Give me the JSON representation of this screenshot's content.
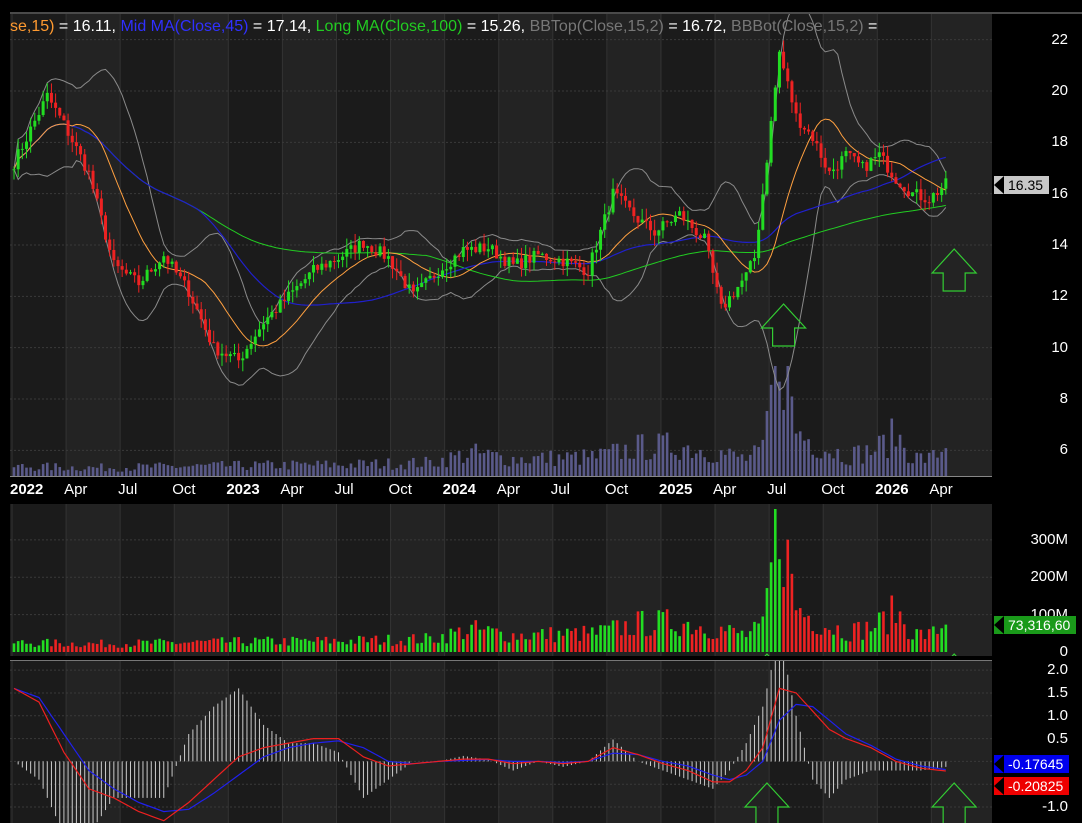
{
  "legend": [
    {
      "text": "se,15)",
      "color": "#ff9a30"
    },
    {
      "text": " = 16.11, ",
      "color": "#ffffff"
    },
    {
      "text": "Mid MA(Close,45)",
      "color": "#3030ff"
    },
    {
      "text": " = 17.14, ",
      "color": "#ffffff"
    },
    {
      "text": "Long MA(Close,100)",
      "color": "#22cc22"
    },
    {
      "text": " = 15.26, ",
      "color": "#ffffff"
    },
    {
      "text": "BBTop(Close,15,2)",
      "color": "#777777"
    },
    {
      "text": " = 16.72, ",
      "color": "#ffffff"
    },
    {
      "text": "BBBot(Close,15,2)",
      "color": "#777777"
    },
    {
      "text": " = ",
      "color": "#ffffff"
    }
  ],
  "x_labels": [
    {
      "text": "2022",
      "year": true,
      "week": 0
    },
    {
      "text": "Apr",
      "year": false,
      "week": 13
    },
    {
      "text": "Jul",
      "year": false,
      "week": 26
    },
    {
      "text": "Oct",
      "year": false,
      "week": 39
    },
    {
      "text": "2023",
      "year": true,
      "week": 52
    },
    {
      "text": "Apr",
      "year": false,
      "week": 65
    },
    {
      "text": "Jul",
      "year": false,
      "week": 78
    },
    {
      "text": "Oct",
      "year": false,
      "week": 91
    },
    {
      "text": "2024",
      "year": true,
      "week": 104
    },
    {
      "text": "Apr",
      "year": false,
      "week": 117
    },
    {
      "text": "Jul",
      "year": false,
      "week": 130
    },
    {
      "text": "Oct",
      "year": false,
      "week": 143
    },
    {
      "text": "2025",
      "year": true,
      "week": 156
    },
    {
      "text": "Apr",
      "year": false,
      "week": 169
    },
    {
      "text": "Jul",
      "year": false,
      "week": 182
    },
    {
      "text": "Oct",
      "year": false,
      "week": 195
    },
    {
      "text": "2026",
      "year": true,
      "week": 208
    },
    {
      "text": "Apr",
      "year": false,
      "week": 221
    }
  ],
  "price_axis": {
    "ticks": [
      "22",
      "20",
      "18",
      "16",
      "14",
      "12",
      "10",
      "8",
      "6"
    ],
    "current": "16.35"
  },
  "volume_axis": {
    "ticks": [
      "300M",
      "200M",
      "100M",
      "0"
    ],
    "current": "73,316,60"
  },
  "macd_axis": {
    "ticks": [
      "2.0",
      "1.5",
      "1.0",
      "0.5",
      "0",
      "-0.5",
      "-1.0"
    ],
    "macd_value": "-0.17645",
    "signal_value": "-0.20825"
  },
  "colors": {
    "up": "#22dd22",
    "down": "#ee2222",
    "short_ma": "#ffa040",
    "mid_ma": "#2020cc",
    "long_ma": "#22cc22",
    "bollinger": "#8a8a8a",
    "vol_overlay": "#5a5a8a",
    "macd": "#ee2020",
    "signal": "#2020ee",
    "hist": "#cccccc",
    "arrow": "#33cc33"
  },
  "chart_data": [
    {
      "type": "line",
      "title": "",
      "x_unit": "week index from Jan 2022",
      "ylim": [
        5,
        23
      ],
      "anchors_x": [
        0,
        8,
        12,
        18,
        24,
        30,
        36,
        42,
        48,
        54,
        60,
        66,
        72,
        78,
        84,
        90,
        96,
        102,
        108,
        114,
        120,
        126,
        132,
        138,
        144,
        150,
        154,
        160,
        166,
        170,
        176,
        178,
        180,
        184,
        188,
        192,
        196,
        200,
        204,
        208,
        212,
        216,
        220,
        224
      ],
      "close": [
        17.2,
        19.8,
        18.7,
        16.8,
        13.2,
        12.5,
        13.6,
        12.2,
        10.0,
        9.5,
        11.0,
        12.0,
        13.0,
        13.5,
        14.1,
        13.5,
        12.0,
        13.0,
        13.8,
        13.9,
        13.2,
        13.6,
        13.4,
        13.0,
        16.0,
        15.0,
        14.5,
        15.2,
        14.2,
        11.5,
        12.8,
        13.5,
        16.0,
        21.5,
        19.0,
        18.2,
        16.8,
        17.5,
        17.0,
        17.5,
        16.6,
        16.0,
        15.8,
        16.35
      ],
      "short_ma_last": 16.11,
      "mid_ma_last": 17.14,
      "long_ma_last": 15.26,
      "bb_top_last": 16.72,
      "grid": true
    },
    {
      "type": "bar",
      "title": "",
      "ylim": [
        0,
        380
      ],
      "y_unit": "millions",
      "anchors_x": [
        0,
        20,
        40,
        60,
        80,
        100,
        110,
        120,
        140,
        150,
        160,
        170,
        176,
        180,
        184,
        188,
        192,
        196,
        200,
        204,
        208,
        212,
        216,
        220,
        224
      ],
      "volume": [
        25,
        22,
        25,
        28,
        30,
        35,
        60,
        45,
        50,
        75,
        80,
        60,
        45,
        65,
        370,
        120,
        90,
        70,
        55,
        60,
        75,
        110,
        50,
        45,
        73.3
      ],
      "last_volume": 73.3166
    },
    {
      "type": "line",
      "title": "",
      "ylim": [
        -1.35,
        2.2
      ],
      "anchors_x": [
        0,
        6,
        12,
        18,
        24,
        30,
        36,
        42,
        48,
        54,
        60,
        66,
        72,
        78,
        84,
        90,
        96,
        102,
        108,
        114,
        120,
        126,
        132,
        138,
        144,
        150,
        156,
        162,
        168,
        172,
        176,
        180,
        184,
        188,
        192,
        196,
        200,
        206,
        212,
        218,
        224
      ],
      "macd": [
        1.6,
        1.3,
        0.2,
        -0.6,
        -0.8,
        -1.1,
        -1.3,
        -0.9,
        -0.4,
        0.1,
        0.3,
        0.4,
        0.5,
        0.5,
        0.1,
        -0.1,
        -0.05,
        0.0,
        0.05,
        0.05,
        -0.05,
        0.0,
        -0.05,
        0.0,
        0.3,
        0.15,
        -0.05,
        -0.2,
        -0.45,
        -0.45,
        -0.2,
        0.3,
        1.6,
        1.5,
        1.1,
        0.7,
        0.5,
        0.3,
        0.0,
        -0.15,
        -0.21
      ],
      "signal": [
        1.6,
        1.4,
        0.6,
        -0.2,
        -0.6,
        -0.9,
        -1.1,
        -1.05,
        -0.7,
        -0.3,
        0.1,
        0.3,
        0.4,
        0.45,
        0.3,
        0.0,
        -0.05,
        0.0,
        0.02,
        0.04,
        0.0,
        0.0,
        -0.02,
        0.0,
        0.18,
        0.15,
        0.0,
        -0.1,
        -0.3,
        -0.4,
        -0.3,
        0.0,
        0.9,
        1.25,
        1.2,
        0.9,
        0.6,
        0.35,
        0.05,
        -0.1,
        -0.18
      ],
      "macd_last": -0.20825,
      "signal_last": -0.17645
    }
  ],
  "signal_arrows": [
    {
      "pane": "price",
      "dir": "up",
      "week": 185
    },
    {
      "pane": "price",
      "dir": "up",
      "week": 226
    },
    {
      "pane": "macd",
      "dir": "up",
      "week": 181
    },
    {
      "pane": "macd",
      "dir": "up",
      "week": 226
    }
  ]
}
